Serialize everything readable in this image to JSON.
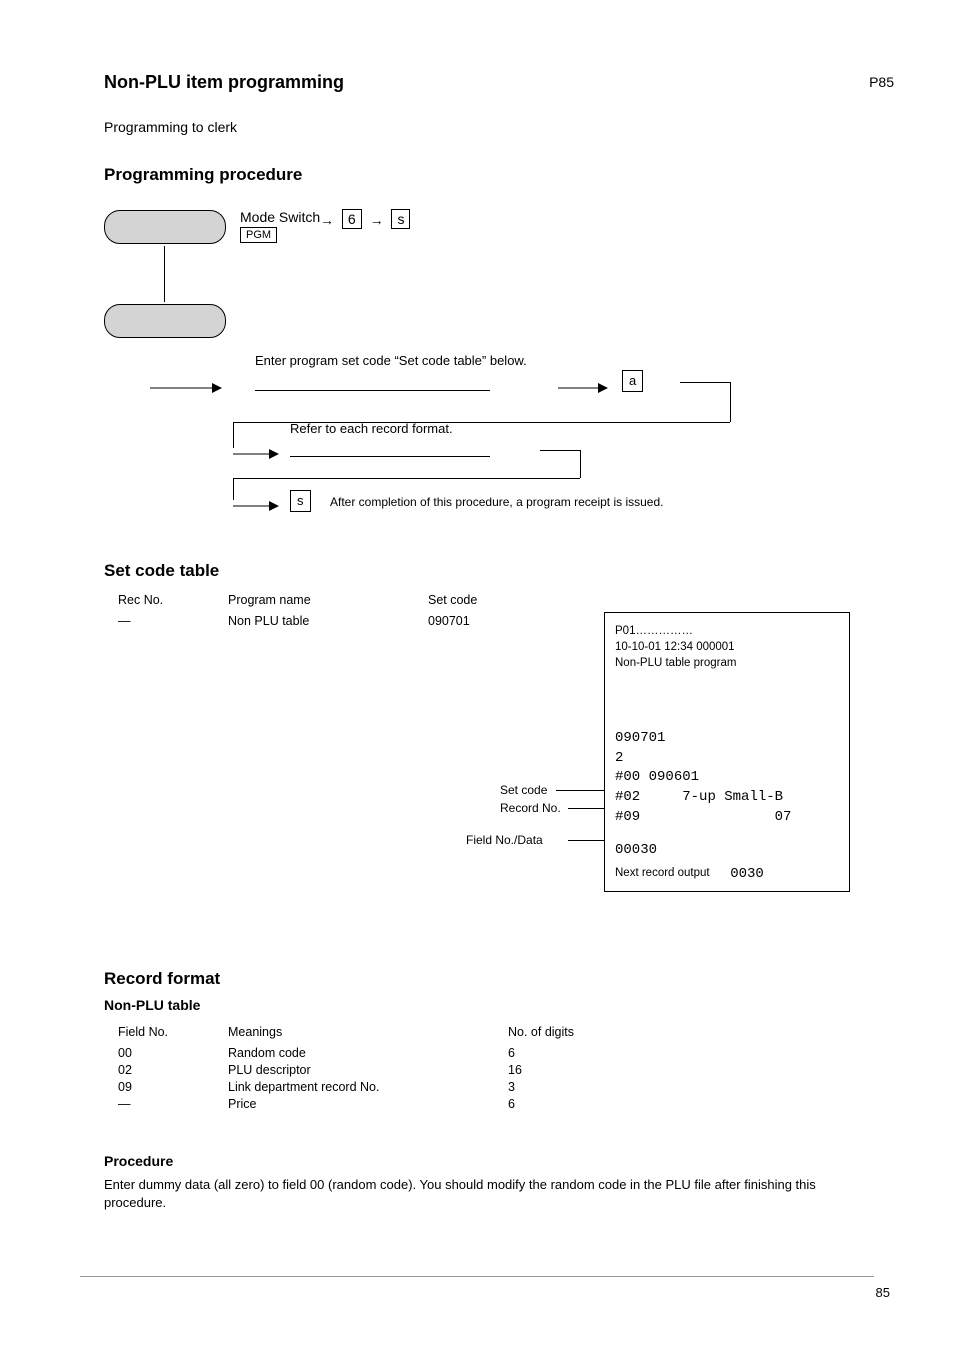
{
  "page": {
    "title": "Non-PLU item programming",
    "number": "P85"
  },
  "intro": "Programming to clerk",
  "proc_heading": "Programming procedure",
  "flow": {
    "step1_label": "Mode Switch",
    "mode_box": "PGM",
    "arrow1a": "6",
    "arrow1b": "s",
    "input1": "Enter program set code “Set code table” below.",
    "after_input1": "a",
    "input2": "Refer to each record format.",
    "final": "s",
    "final_note": "After completion of this procedure, a program receipt is issued."
  },
  "set_code_heading": "Set code table",
  "set_code_table": {
    "headers": [
      "Rec No.",
      "Program name",
      "Set code"
    ],
    "rows": [
      [
        "—",
        "Non PLU table",
        "090701"
      ]
    ]
  },
  "receipt": {
    "header": [
      "P01……………",
      "10-10-01 12:34  000001",
      "Non-PLU table program"
    ],
    "set_code": "090701",
    "rec_no": "2",
    "lines": [
      [
        "#00",
        "090601",
        ""
      ],
      [
        "#02",
        "",
        "7-up Small-B"
      ],
      [
        "#09",
        "",
        "07"
      ]
    ],
    "body": "00030",
    "footer_label": "Next record output",
    "footer_value": "0030"
  },
  "annotations": [
    "Set code",
    "Record No.",
    "Field No./Data"
  ],
  "format_heading": "Record format",
  "format_subheading": "Non-PLU table",
  "format_table": {
    "headers": [
      "Field No.",
      "Meanings",
      "No. of digits"
    ],
    "rows": [
      [
        "00",
        "Random code",
        "6"
      ],
      [
        "02",
        "PLU descriptor",
        "16"
      ],
      [
        "09",
        "Link department record No.",
        "3"
      ],
      [
        "—",
        "Price",
        "6"
      ]
    ]
  },
  "procedure_heading": "Procedure",
  "procedure_text": "Enter dummy data (all zero) to field 00 (random code). You should modify the random code in the PLU file after finishing this procedure.",
  "footer_page": "85"
}
